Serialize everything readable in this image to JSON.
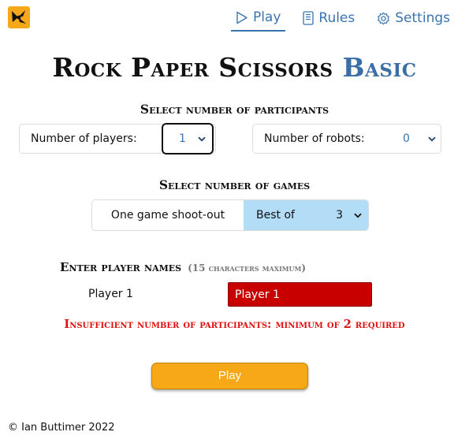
{
  "nav": {
    "items": [
      {
        "label": "Play",
        "icon": "play-icon",
        "active": true
      },
      {
        "label": "Rules",
        "icon": "rules-icon",
        "active": false
      },
      {
        "label": "Settings",
        "icon": "gear-icon",
        "active": false
      }
    ]
  },
  "title": {
    "main": "Rock Paper Scissors",
    "accent": "Basic"
  },
  "participants": {
    "heading": "Select number of participants",
    "players_label": "Number of players:",
    "players_value": "1",
    "robots_label": "Number of robots:",
    "robots_value": "0"
  },
  "games": {
    "heading": "Select number of games",
    "shootout_label": "One game shoot-out",
    "bestof_label": "Best of",
    "bestof_value": "3"
  },
  "names": {
    "heading": "Enter player names",
    "subheading": "(15 characters maximum)",
    "player1_label": "Player 1",
    "player1_value": "Player 1"
  },
  "error": "Insufficient number of participants: minimum of 2 required",
  "play_button": "Play",
  "footer": "© Ian Buttimer 2022",
  "colors": {
    "accent": "#3a74b0",
    "logo_bg": "#f5a818",
    "play_button": "#f7a817",
    "error": "#e01010",
    "input_error_bg": "#c80000",
    "bestof_bg": "#b3dcf7"
  }
}
